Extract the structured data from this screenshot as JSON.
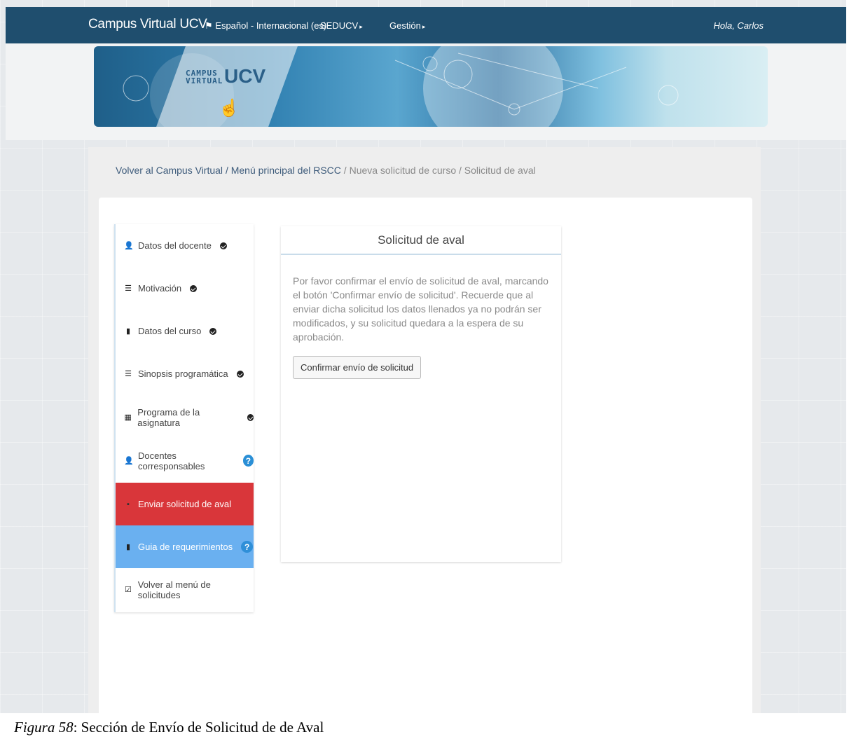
{
  "topbar": {
    "brand": "Campus Virtual UCV",
    "language": "Español - Internacional (es)",
    "menu_seducv": "SEDUCV",
    "menu_gestion": "Gestión",
    "greeting": "Hola, Carlos"
  },
  "banner": {
    "logo_text_line1": "CAMPUS",
    "logo_text_line2": "VIRTUAL",
    "logo_ucv": "UCV"
  },
  "breadcrumb": {
    "item1": "Volver al Campus Virtual",
    "item2": "Menú principal del RSCC",
    "item3": "Nueva solicitud de curso",
    "item4": "Solicitud de aval",
    "separator": "/"
  },
  "sidebar": {
    "items": [
      {
        "label": "Datos del docente",
        "icon": "user-icon",
        "status": "check"
      },
      {
        "label": "Motivación",
        "icon": "list-icon",
        "status": "check"
      },
      {
        "label": "Datos del curso",
        "icon": "book-icon",
        "status": "check"
      },
      {
        "label": "Sinopsis programática",
        "icon": "list-icon",
        "status": "check"
      },
      {
        "label": "Programa de la asignatura",
        "icon": "calendar-icon",
        "status": "check"
      },
      {
        "label": "Docentes corresponsables",
        "icon": "user-icon",
        "status": "question"
      },
      {
        "label": "Enviar solicitud de aval",
        "icon": "send-icon",
        "status": "none"
      },
      {
        "label": "Guia de requerimientos",
        "icon": "file-icon",
        "status": "question"
      },
      {
        "label": "Volver al menú de solicitudes",
        "icon": "check-square-icon",
        "status": "none"
      }
    ],
    "question_mark": "?"
  },
  "panel": {
    "title": "Solicitud de aval",
    "body": "Por favor confirmar el envío de solicitud de aval, marcando el botón 'Confirmar envío de solicitud'. Recuerde que al enviar dicha solicitud los datos llenados ya no podrán ser modificados, y su solicitud quedara a la espera de su aprobación.",
    "button": "Confirmar envío de solicitud"
  },
  "caption": {
    "figure": "Figura 58",
    "text": ": Sección de Envío de Solicitud de de Aval"
  },
  "colors": {
    "topbar": "#1f4e6e",
    "active_item": "#d9363a",
    "guide_item": "#6ab0f0",
    "question_badge": "#2a8fd6"
  }
}
